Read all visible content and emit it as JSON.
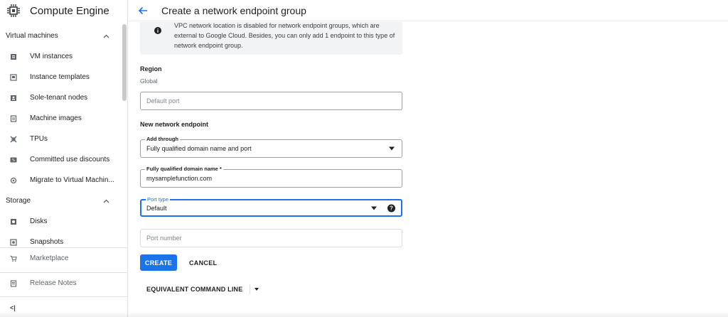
{
  "app": {
    "title": "Compute Engine"
  },
  "sidebar": {
    "sections": [
      {
        "label": "Virtual machines",
        "items": [
          {
            "label": "VM instances",
            "icon": "vm-instances-icon"
          },
          {
            "label": "Instance templates",
            "icon": "instance-templates-icon"
          },
          {
            "label": "Sole-tenant nodes",
            "icon": "sole-tenant-icon"
          },
          {
            "label": "Machine images",
            "icon": "machine-images-icon"
          },
          {
            "label": "TPUs",
            "icon": "tpu-icon"
          },
          {
            "label": "Committed use discounts",
            "icon": "discount-icon"
          },
          {
            "label": "Migrate to Virtual Machin...",
            "icon": "migrate-icon"
          }
        ]
      },
      {
        "label": "Storage",
        "items": [
          {
            "label": "Disks",
            "icon": "disk-icon"
          },
          {
            "label": "Snapshots",
            "icon": "snapshot-icon"
          }
        ]
      }
    ],
    "bottom": {
      "marketplace": "Marketplace",
      "release_notes": "Release Notes",
      "collapse_glyph": "<|"
    }
  },
  "header": {
    "title": "Create a network endpoint group"
  },
  "form": {
    "info_text": "VPC network location is disabled for network endpoint groups, which are external to Google Cloud. Besides, you can only add 1 endpoint to this type of network endpoint group.",
    "region_label": "Region",
    "region_value": "Global",
    "default_port_placeholder": "Default port",
    "new_endpoint_title": "New network endpoint",
    "add_through": {
      "label": "Add through",
      "value": "Fully qualified domain name and port"
    },
    "fqdn": {
      "label": "Fully qualified domain name *",
      "value": "mysamplefunction.com"
    },
    "port_type": {
      "label": "Port type",
      "value": "Default",
      "help_glyph": "?"
    },
    "port_number_placeholder": "Port number",
    "create_label": "CREATE",
    "cancel_label": "CANCEL",
    "equivalent_cmd_label": "EQUIVALENT COMMAND LINE"
  },
  "colors": {
    "accent": "#1a73e8",
    "info_bg": "#f1f3f4",
    "text": "#202124"
  }
}
